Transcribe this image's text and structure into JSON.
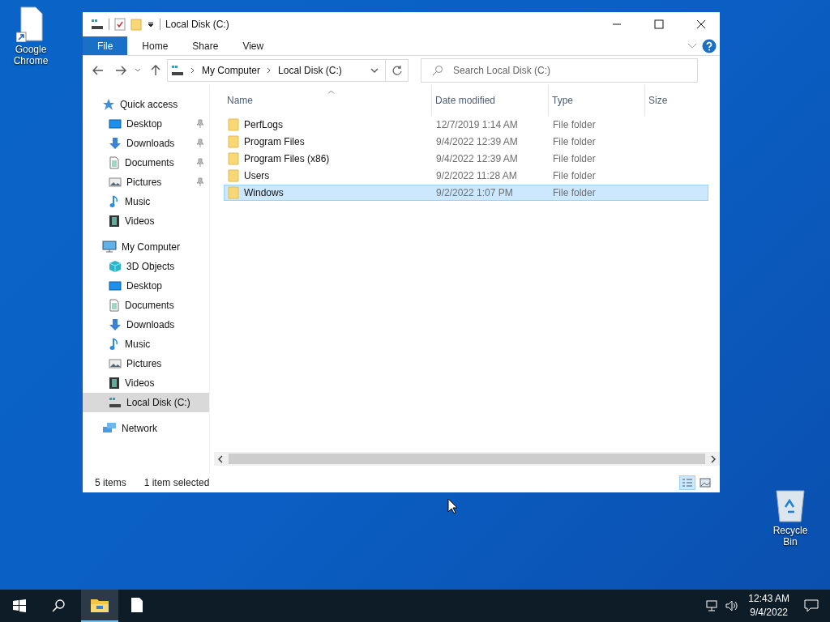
{
  "desktop_icons": [
    {
      "label": "Google Chrome",
      "kind": "shortcut"
    },
    {
      "label": "Recycle Bin",
      "kind": "recycle"
    }
  ],
  "window": {
    "title": "Local Disk (C:)"
  },
  "ribbon": {
    "tabs": [
      {
        "label": "File",
        "selected": true
      },
      {
        "label": "Home",
        "selected": false
      },
      {
        "label": "Share",
        "selected": false
      },
      {
        "label": "View",
        "selected": false
      }
    ]
  },
  "address": {
    "crumbs": [
      "My Computer",
      "Local Disk (C:)"
    ]
  },
  "search": {
    "placeholder": "Search Local Disk (C:)"
  },
  "sidebar": {
    "items": [
      {
        "label": "Quick access",
        "kind": "star",
        "selected": false,
        "children": [
          {
            "label": "Desktop",
            "kind": "desktop",
            "selected": false,
            "pinned": true
          },
          {
            "label": "Downloads",
            "kind": "download",
            "selected": false,
            "pinned": true
          },
          {
            "label": "Documents",
            "kind": "document",
            "selected": false,
            "pinned": true
          },
          {
            "label": "Pictures",
            "kind": "picture",
            "selected": false,
            "pinned": true
          },
          {
            "label": "Music",
            "kind": "music",
            "selected": false,
            "pinned": false
          },
          {
            "label": "Videos",
            "kind": "video",
            "selected": false,
            "pinned": false
          }
        ]
      },
      {
        "label": "My Computer",
        "kind": "computer",
        "selected": false,
        "children": [
          {
            "label": "3D Objects",
            "kind": "cube",
            "selected": false,
            "pinned": false
          },
          {
            "label": "Desktop",
            "kind": "desktop",
            "selected": false,
            "pinned": false
          },
          {
            "label": "Documents",
            "kind": "document",
            "selected": false,
            "pinned": false
          },
          {
            "label": "Downloads",
            "kind": "download",
            "selected": false,
            "pinned": false
          },
          {
            "label": "Music",
            "kind": "music",
            "selected": false,
            "pinned": false
          },
          {
            "label": "Pictures",
            "kind": "picture",
            "selected": false,
            "pinned": false
          },
          {
            "label": "Videos",
            "kind": "video",
            "selected": false,
            "pinned": false
          },
          {
            "label": "Local Disk (C:)",
            "kind": "drive",
            "selected": true,
            "pinned": false
          }
        ]
      },
      {
        "label": "Network",
        "kind": "network",
        "selected": false
      }
    ]
  },
  "table": {
    "columns": [
      {
        "label": "Name",
        "sorted": true
      },
      {
        "label": "Date modified",
        "sorted": false
      },
      {
        "label": "Type",
        "sorted": false
      },
      {
        "label": "Size",
        "sorted": false
      }
    ],
    "rows": [
      {
        "name": "PerfLogs",
        "date": "12/7/2019 1:14 AM",
        "type": "File folder",
        "selected": false
      },
      {
        "name": "Program Files",
        "date": "9/4/2022 12:39 AM",
        "type": "File folder",
        "selected": false
      },
      {
        "name": "Program Files (x86)",
        "date": "9/4/2022 12:39 AM",
        "type": "File folder",
        "selected": false
      },
      {
        "name": "Users",
        "date": "9/2/2022 11:28 AM",
        "type": "File folder",
        "selected": false
      },
      {
        "name": "Windows",
        "date": "9/2/2022 1:07 PM",
        "type": "File folder",
        "selected": true
      }
    ]
  },
  "status_bar": {
    "item_count": "5 items",
    "selection": "1 item selected",
    "views": [
      {
        "kind": "details",
        "selected": true
      },
      {
        "kind": "large",
        "selected": false
      }
    ]
  },
  "taskbar": {
    "apps": [
      {
        "kind": "explorer",
        "selected": true
      },
      {
        "kind": "file",
        "selected": false
      }
    ],
    "time": "12:43 AM",
    "date": "9/4/2022"
  }
}
